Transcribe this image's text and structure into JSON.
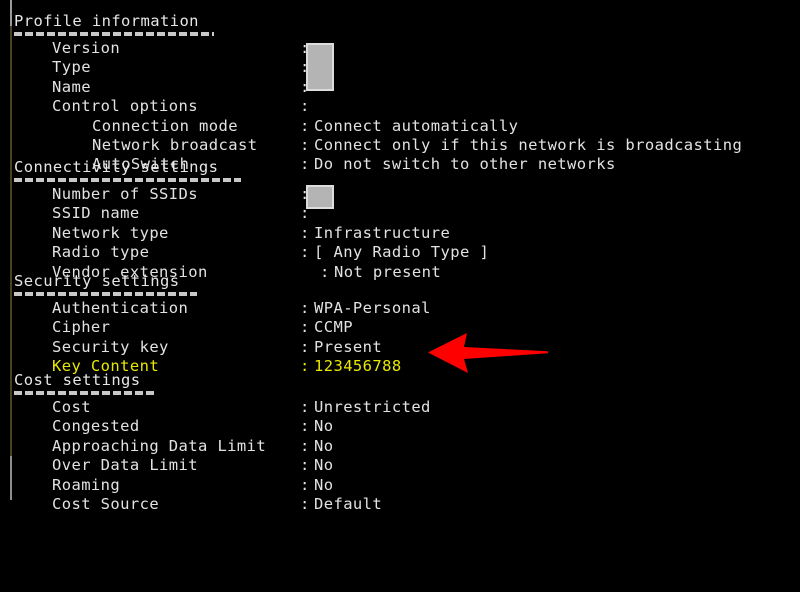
{
  "window": {
    "background_color": "#000000",
    "text_color": "#e2e2e2",
    "highlight_color": "#e8e800",
    "arrow_color": "#fe0000",
    "redaction_color": "#b4b4b4"
  },
  "sections": [
    {
      "title": "Profile information",
      "rows": [
        {
          "label": "Version",
          "colon": ":",
          "value": "",
          "indent": "normal",
          "redacted": true
        },
        {
          "label": "Type",
          "colon": ":",
          "value": "",
          "indent": "normal",
          "redacted": true
        },
        {
          "label": "Name",
          "colon": ":",
          "value": "",
          "indent": "normal",
          "redacted": true
        },
        {
          "label": "Control options",
          "colon": ":",
          "value": "",
          "indent": "normal"
        },
        {
          "label": "Connection mode",
          "colon": ":",
          "value": "Connect automatically",
          "indent": "sub"
        },
        {
          "label": "Network broadcast",
          "colon": ":",
          "value": "Connect only if this network is broadcasting",
          "indent": "sub"
        },
        {
          "label": "AutoSwitch",
          "colon": ":",
          "value": "Do not switch to other networks",
          "indent": "sub"
        }
      ]
    },
    {
      "title": "Connectivity settings",
      "rows": [
        {
          "label": "Number of SSIDs",
          "colon": ":",
          "value": "",
          "indent": "normal",
          "redacted": true
        },
        {
          "label": "SSID name",
          "colon": ":",
          "value": "",
          "indent": "normal",
          "redacted": true
        },
        {
          "label": "Network type",
          "colon": ":",
          "value": "Infrastructure",
          "indent": "normal"
        },
        {
          "label": "Radio type",
          "colon": ":",
          "value": "[ Any Radio Type ]",
          "indent": "normal"
        },
        {
          "label": "Vendor extension",
          "colon": ":",
          "value": "Not present",
          "indent": "normal",
          "colon_shift": true
        }
      ]
    },
    {
      "title": "Security settings",
      "rows": [
        {
          "label": "Authentication",
          "colon": ":",
          "value": "WPA-Personal",
          "indent": "normal"
        },
        {
          "label": "Cipher",
          "colon": ":",
          "value": "CCMP",
          "indent": "normal"
        },
        {
          "label": "Security key",
          "colon": ":",
          "value": "Present",
          "indent": "normal"
        },
        {
          "label": "Key Content",
          "colon": ":",
          "value": "123456788",
          "indent": "normal",
          "highlight": true
        }
      ]
    },
    {
      "title": "Cost settings",
      "rows": [
        {
          "label": "Cost",
          "colon": ":",
          "value": "Unrestricted",
          "indent": "normal"
        },
        {
          "label": "Congested",
          "colon": ":",
          "value": "No",
          "indent": "normal"
        },
        {
          "label": "Approaching Data Limit",
          "colon": ":",
          "value": "No",
          "indent": "normal"
        },
        {
          "label": "Over Data Limit",
          "colon": ":",
          "value": "No",
          "indent": "normal"
        },
        {
          "label": "Roaming",
          "colon": ":",
          "value": "No",
          "indent": "normal"
        },
        {
          "label": "Cost Source",
          "colon": ":",
          "value": "Default",
          "indent": "normal"
        }
      ]
    }
  ],
  "annotation": {
    "arrow_label": "red-arrow-pointing-at-key-content",
    "arrow_color": "#fe0000"
  }
}
